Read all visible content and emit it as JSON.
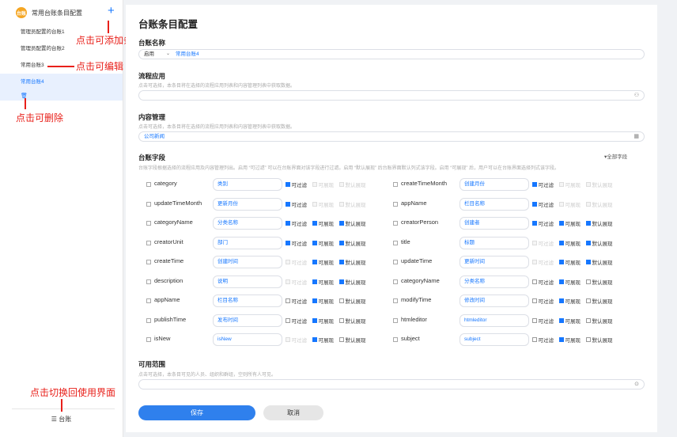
{
  "sidebar": {
    "logo": "台账",
    "title": "常用台账条目配置",
    "add_icon": "+",
    "items": [
      {
        "label": "管理员配置的台账1"
      },
      {
        "label": "管理员配置的台账2"
      },
      {
        "label": "常用台账3"
      },
      {
        "label": "常用台账4"
      }
    ],
    "trash_icon": "🗑",
    "footer_icon": "☰",
    "footer_label": "台账"
  },
  "annotations": {
    "add": "点击可添加条目",
    "edit": "点击可编辑",
    "delete": "点击可删除",
    "switch": "点击切换回使用界面"
  },
  "main": {
    "title": "台账条目配置",
    "name_section": {
      "title": "台账名称",
      "status": "启用",
      "chevron": "⌄",
      "value": "常用台账4"
    },
    "process_section": {
      "title": "流程应用",
      "hint": "点击可选择，本条目将在选择的流程应用列表和内容管理列表中获取数据。",
      "value": "",
      "icon": "⚇"
    },
    "content_section": {
      "title": "内容管理",
      "hint": "点击可选择，本条目将在选择的流程应用列表和内容管理列表中获取数据。",
      "value": "公司新闻",
      "icon": "▦"
    },
    "fields_section": {
      "title": "台账字段",
      "all_fields": "▾全部字段",
      "hint": "台账字段根据选择的流程应用及内容管理列出。启用 “可过滤” 可以在台账界面对该字段进行过滤。启用 “默认展现” 后台账界面默认列式该字段。启用 “可展现” 后，用户可以在台账界面选择列式该字段。",
      "opt_labels": {
        "filter": "可过滤",
        "show": "可展现",
        "default": "默认展现"
      },
      "rows": [
        [
          {
            "name": "category",
            "value": "类别",
            "filter": "on",
            "show": "dis",
            "default": "dis"
          },
          {
            "name": "createTimeMonth",
            "value": "创建月份",
            "filter": "on",
            "show": "dis",
            "default": "dis"
          }
        ],
        [
          {
            "name": "updateTimeMonth",
            "value": "更新月份",
            "filter": "on",
            "show": "dis",
            "default": "dis"
          },
          {
            "name": "appName",
            "value": "栏目名称",
            "filter": "on",
            "show": "dis",
            "default": "dis"
          }
        ],
        [
          {
            "name": "categoryName",
            "value": "分类名称",
            "filter": "on",
            "show": "on",
            "default": "on"
          },
          {
            "name": "creatorPerson",
            "value": "创建者",
            "filter": "on",
            "show": "on",
            "default": "on"
          }
        ],
        [
          {
            "name": "creatorUnit",
            "value": "部门",
            "filter": "on",
            "show": "on",
            "default": "on"
          },
          {
            "name": "title",
            "value": "标题",
            "filter": "dis",
            "show": "on",
            "default": "on"
          }
        ],
        [
          {
            "name": "createTime",
            "value": "创建时间",
            "filter": "dis",
            "show": "on",
            "default": "on"
          },
          {
            "name": "updateTime",
            "value": "更新时间",
            "filter": "dis",
            "show": "on",
            "default": "on"
          }
        ],
        [
          {
            "name": "description",
            "value": "说明",
            "filter": "dis",
            "show": "on",
            "default": "on"
          },
          {
            "name": "categoryName",
            "value": "分类名称",
            "filter": "off",
            "show": "on",
            "default": "off"
          }
        ],
        [
          {
            "name": "appName",
            "value": "栏目名称",
            "filter": "off",
            "show": "on",
            "default": "off"
          },
          {
            "name": "modifyTime",
            "value": "修改时间",
            "filter": "off",
            "show": "on",
            "default": "off"
          }
        ],
        [
          {
            "name": "publishTime",
            "value": "发布时间",
            "filter": "off",
            "show": "on",
            "default": "off"
          },
          {
            "name": "htmleditor",
            "value": "htmleditor",
            "filter": "off",
            "show": "on",
            "default": "off"
          }
        ],
        [
          {
            "name": "isNew",
            "value": "isNew",
            "filter": "dis",
            "show": "on",
            "default": "off"
          },
          {
            "name": "subject",
            "value": "subject",
            "filter": "off",
            "show": "on",
            "default": "off"
          }
        ]
      ]
    },
    "scope_section": {
      "title": "可用范围",
      "hint": "点击可选择，本条目可见的人员、组织和群组，空则所有人可见。",
      "value": "",
      "icon": "⊙"
    },
    "save_label": "保存",
    "cancel_label": "取消"
  }
}
